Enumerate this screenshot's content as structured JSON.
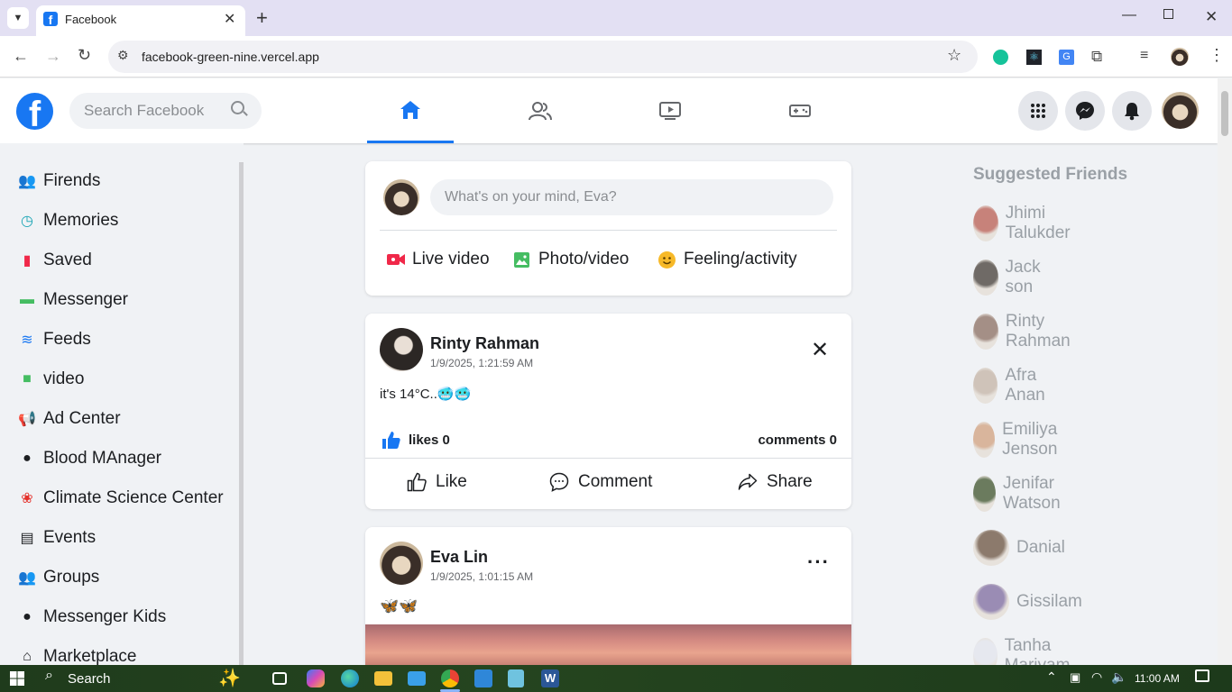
{
  "browser": {
    "tab_title": "Facebook",
    "url": "facebook-green-nine.vercel.app"
  },
  "header": {
    "logo": "f",
    "search_placeholder": "Search Facebook",
    "nav": [
      "home-icon",
      "friends-icon",
      "watch-icon",
      "gaming-icon"
    ]
  },
  "sidebar": {
    "items": [
      {
        "label": "Firends",
        "icon": "friends-icon",
        "color": "#1c1e21"
      },
      {
        "label": "Memories",
        "icon": "clock-icon",
        "color": "#18a4b4"
      },
      {
        "label": "Saved",
        "icon": "bookmark-icon",
        "color": "#f02849"
      },
      {
        "label": "Messenger",
        "icon": "chat-icon",
        "color": "#45bd62"
      },
      {
        "label": "Feeds",
        "icon": "feeds-icon",
        "color": "#1877f2"
      },
      {
        "label": "video",
        "icon": "video-icon",
        "color": "#45bd62"
      },
      {
        "label": "Ad Center",
        "icon": "megaphone-icon",
        "color": "#1c1e21"
      },
      {
        "label": "Blood MAnager",
        "icon": "blood-drop-icon",
        "color": "#1c1e21"
      },
      {
        "label": "Climate Science Center",
        "icon": "leaf-icon",
        "color": "#e4312b"
      },
      {
        "label": "Events",
        "icon": "calendar-icon",
        "color": "#1c1e21"
      },
      {
        "label": "Groups",
        "icon": "groups-icon",
        "color": "#1c1e21"
      },
      {
        "label": "Messenger Kids",
        "icon": "chat-bubble-icon",
        "color": "#1c1e21"
      },
      {
        "label": "Marketplace",
        "icon": "store-icon",
        "color": "#1c1e21"
      }
    ]
  },
  "composer": {
    "placeholder": "What's on your mind, Eva?",
    "live": "Live video",
    "photo": "Photo/video",
    "feeling": "Feeling/activity"
  },
  "posts": [
    {
      "author": "Rinty Rahman",
      "time": "1/9/2025, 1:21:59 AM",
      "text": "it's 14°C..🥶🥶",
      "likes": "likes 0",
      "comments": "comments 0",
      "like": "Like",
      "comment": "Comment",
      "share": "Share"
    },
    {
      "author": "Eva Lin",
      "time": "1/9/2025, 1:01:15 AM",
      "text": "🦋🦋"
    }
  ],
  "suggested": {
    "title": "Suggested Friends",
    "friends": [
      "Jhimi Talukder",
      "Jack son",
      "Rinty Rahman",
      "Afra Anan",
      "Emiliya Jenson",
      "Jenifar Watson",
      "Danial",
      "Gissilam",
      "Tanha Mariyam"
    ]
  },
  "taskbar": {
    "search": "Search",
    "time": "11:00 AM"
  }
}
